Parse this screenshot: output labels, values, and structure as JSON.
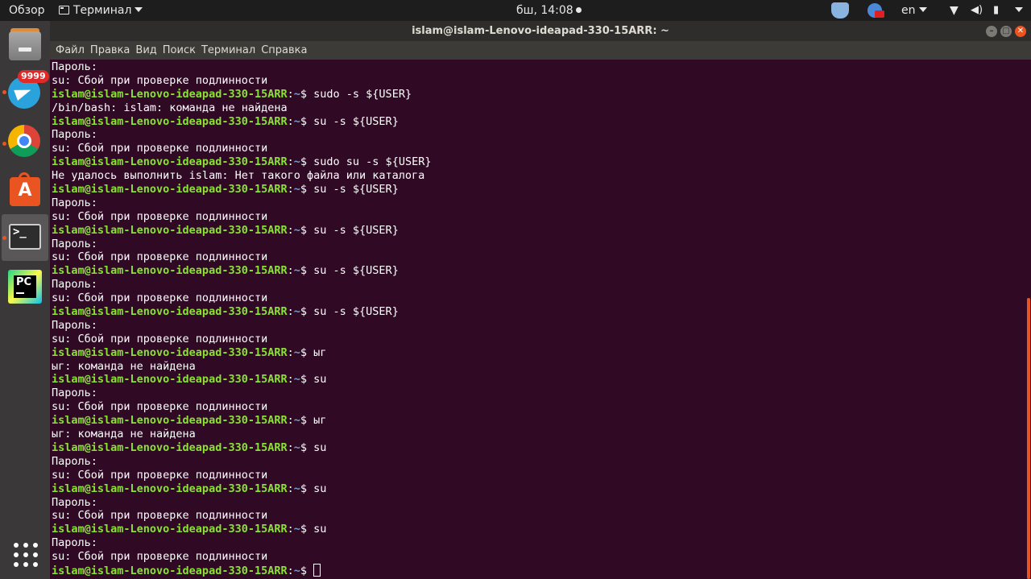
{
  "topbar": {
    "overview_label": "Обзор",
    "app_label": "Терминал",
    "clock": "бш, 14:08",
    "language": "en"
  },
  "dock": {
    "telegram_badge": "9999",
    "items": [
      "files",
      "telegram",
      "chrome",
      "ubuntu-software",
      "terminal",
      "pycharm",
      "show-applications"
    ]
  },
  "window": {
    "title": "islam@islam-Lenovo-ideapad-330-15ARR: ~"
  },
  "menu": {
    "items": [
      "Файл",
      "Правка",
      "Вид",
      "Поиск",
      "Терминал",
      "Справка"
    ]
  },
  "prompt": {
    "user_host": "islam@islam-Lenovo-ideapad-330-15ARR",
    "path": "~",
    "symbol": "$ "
  },
  "terminal_lines": [
    {
      "type": "out",
      "text": "Пароль:"
    },
    {
      "type": "out",
      "text": "su: Сбой при проверке подлинности"
    },
    {
      "type": "cmd",
      "text": "sudo -s ${USER}"
    },
    {
      "type": "out",
      "text": "/bin/bash: islam: команда не найдена"
    },
    {
      "type": "cmd",
      "text": "su -s ${USER}"
    },
    {
      "type": "out",
      "text": "Пароль:"
    },
    {
      "type": "out",
      "text": "su: Сбой при проверке подлинности"
    },
    {
      "type": "cmd",
      "text": "sudo su -s ${USER}"
    },
    {
      "type": "out",
      "text": "Не удалось выполнить islam: Нет такого файла или каталога"
    },
    {
      "type": "cmd",
      "text": "su -s ${USER}"
    },
    {
      "type": "out",
      "text": "Пароль:"
    },
    {
      "type": "out",
      "text": "su: Сбой при проверке подлинности"
    },
    {
      "type": "cmd",
      "text": "su -s ${USER}"
    },
    {
      "type": "out",
      "text": "Пароль:"
    },
    {
      "type": "out",
      "text": "su: Сбой при проверке подлинности"
    },
    {
      "type": "cmd",
      "text": "su -s ${USER}"
    },
    {
      "type": "out",
      "text": "Пароль:"
    },
    {
      "type": "out",
      "text": "su: Сбой при проверке подлинности"
    },
    {
      "type": "cmd",
      "text": "su -s ${USER}"
    },
    {
      "type": "out",
      "text": "Пароль:"
    },
    {
      "type": "out",
      "text": "su: Сбой при проверке подлинности"
    },
    {
      "type": "cmd",
      "text": "ыг"
    },
    {
      "type": "out",
      "text": "ыг: команда не найдена"
    },
    {
      "type": "cmd",
      "text": "su"
    },
    {
      "type": "out",
      "text": "Пароль:"
    },
    {
      "type": "out",
      "text": "su: Сбой при проверке подлинности"
    },
    {
      "type": "cmd",
      "text": "ыг"
    },
    {
      "type": "out",
      "text": "ыг: команда не найдена"
    },
    {
      "type": "cmd",
      "text": "su"
    },
    {
      "type": "out",
      "text": "Пароль:"
    },
    {
      "type": "out",
      "text": "su: Сбой при проверке подлинности"
    },
    {
      "type": "cmd",
      "text": "su"
    },
    {
      "type": "out",
      "text": "Пароль:"
    },
    {
      "type": "out",
      "text": "su: Сбой при проверке подлинности"
    },
    {
      "type": "cmd",
      "text": "su"
    },
    {
      "type": "out",
      "text": "Пароль:"
    },
    {
      "type": "out",
      "text": "su: Сбой при проверке подлинности"
    },
    {
      "type": "current",
      "text": ""
    }
  ],
  "colors": {
    "terminal_bg": "#300a24",
    "prompt_user": "#8ae234",
    "prompt_path": "#729fcf",
    "accent": "#e95420"
  }
}
